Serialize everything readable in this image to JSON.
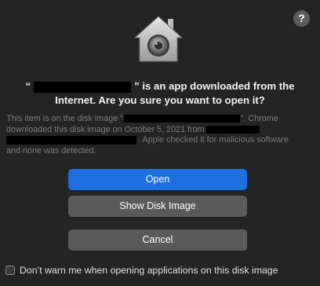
{
  "dialog": {
    "help_label": "?",
    "icon_name": "gatekeeper-house-icon",
    "title": {
      "line1_open_quote": "“",
      "line1_rest": "” is an app downloaded from the",
      "line2": "Internet. Are you sure you want to open it?"
    },
    "body": {
      "line1_start": "This item is on the disk image “",
      "line1_end": "”. Chrome",
      "line2_start": "downloaded this disk image on October 5, 2021 from",
      "line3_end": ". Apple checked it for malicious software",
      "line4": "and none was detected."
    },
    "buttons": {
      "open": "Open",
      "show_disk_image": "Show Disk Image",
      "cancel": "Cancel"
    },
    "dont_warn": {
      "checked": false,
      "label": "Don’t warn me when opening applications on this disk image"
    }
  },
  "colors": {
    "background": "#242424",
    "primary_button": "#1f6fe0",
    "secondary_button": "#5a5a5a",
    "muted_text": "#7a7a7a"
  }
}
